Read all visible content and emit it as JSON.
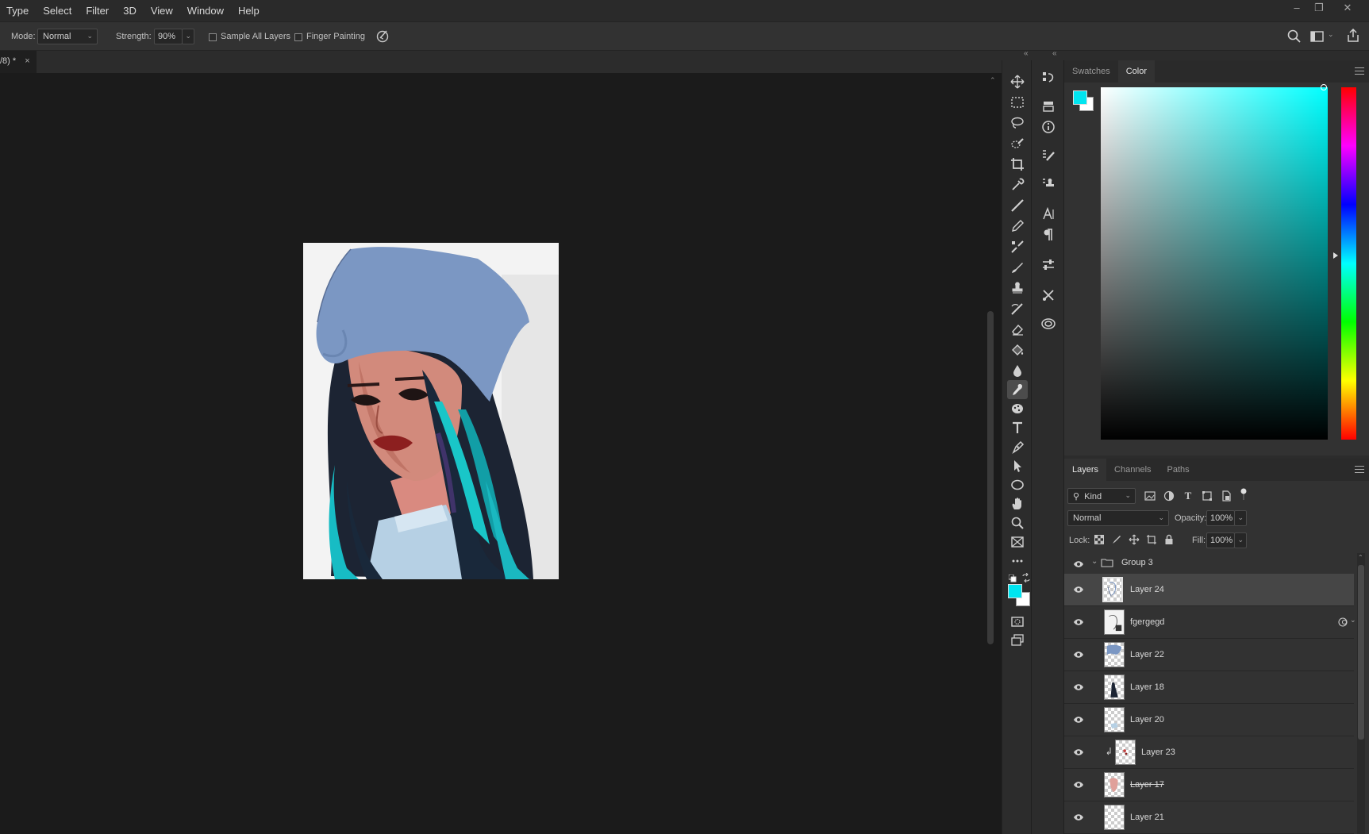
{
  "menubar": {
    "items": [
      "Type",
      "Select",
      "Filter",
      "3D",
      "View",
      "Window",
      "Help"
    ]
  },
  "window_controls": {
    "minimize": "–",
    "restore": "❐",
    "close": "✕"
  },
  "options_bar": {
    "mode_label": "Mode:",
    "mode_value": "Normal",
    "strength_label": "Strength:",
    "strength_value": "90%",
    "sample_all_layers_label": "Sample All Layers",
    "sample_all_layers_checked": false,
    "finger_painting_label": "Finger Painting",
    "finger_painting_checked": false
  },
  "document": {
    "tab_title": "/8) *",
    "tab_close": "×"
  },
  "color_panel": {
    "tabs": [
      "Swatches",
      "Color"
    ],
    "active_tab": "Color",
    "foreground_color": "#00e5f0",
    "background_color": "#ffffff"
  },
  "layers_panel": {
    "tabs": [
      "Layers",
      "Channels",
      "Paths"
    ],
    "active_tab": "Layers",
    "filter_kind": "Kind",
    "blend_mode": "Normal",
    "opacity_label": "Opacity:",
    "opacity_value": "100%",
    "lock_label": "Lock:",
    "fill_label": "Fill:",
    "fill_value": "100%",
    "group_name": "Group 3",
    "layers": [
      {
        "name": "Layer 24",
        "selected": true
      },
      {
        "name": "fgergegd",
        "selected": false,
        "smart_object": true
      },
      {
        "name": "Layer 22",
        "selected": false
      },
      {
        "name": "Layer 18",
        "selected": false
      },
      {
        "name": "Layer 20",
        "selected": false
      },
      {
        "name": "Layer 23",
        "selected": false,
        "clipped": true
      },
      {
        "name": "Layer 17",
        "selected": false,
        "strikethrough": true
      },
      {
        "name": "Layer 21",
        "selected": false
      }
    ]
  },
  "accent_colors": {
    "hat": "#7b97c3",
    "hair_teal": "#19c6c8",
    "skin": "#c98272",
    "panel_bg": "#2c2c2c",
    "canvas_bg": "#1b1b1b"
  }
}
